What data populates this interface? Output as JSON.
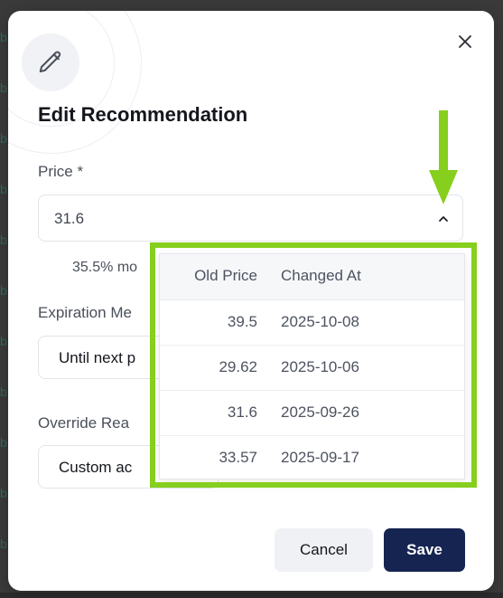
{
  "modal": {
    "title": "Edit Recommendation",
    "icon": "pencil-icon",
    "close_icon": "close-icon"
  },
  "price": {
    "label": "Price *",
    "value": "31.6",
    "helper": "35.5% mo"
  },
  "expiration": {
    "label": "Expiration Me",
    "value": "Until next p"
  },
  "override": {
    "label": "Override Rea",
    "value": "Custom ac"
  },
  "price_history": {
    "headers": {
      "old_price": "Old Price",
      "changed_at": "Changed At"
    },
    "rows": [
      {
        "old_price": "39.5",
        "changed_at": "2025-10-08"
      },
      {
        "old_price": "29.62",
        "changed_at": "2025-10-06"
      },
      {
        "old_price": "31.6",
        "changed_at": "2025-09-26"
      },
      {
        "old_price": "33.57",
        "changed_at": "2025-09-17"
      }
    ]
  },
  "buttons": {
    "cancel": "Cancel",
    "save": "Save"
  },
  "colors": {
    "highlight": "#86cf1e",
    "primary": "#162452"
  }
}
